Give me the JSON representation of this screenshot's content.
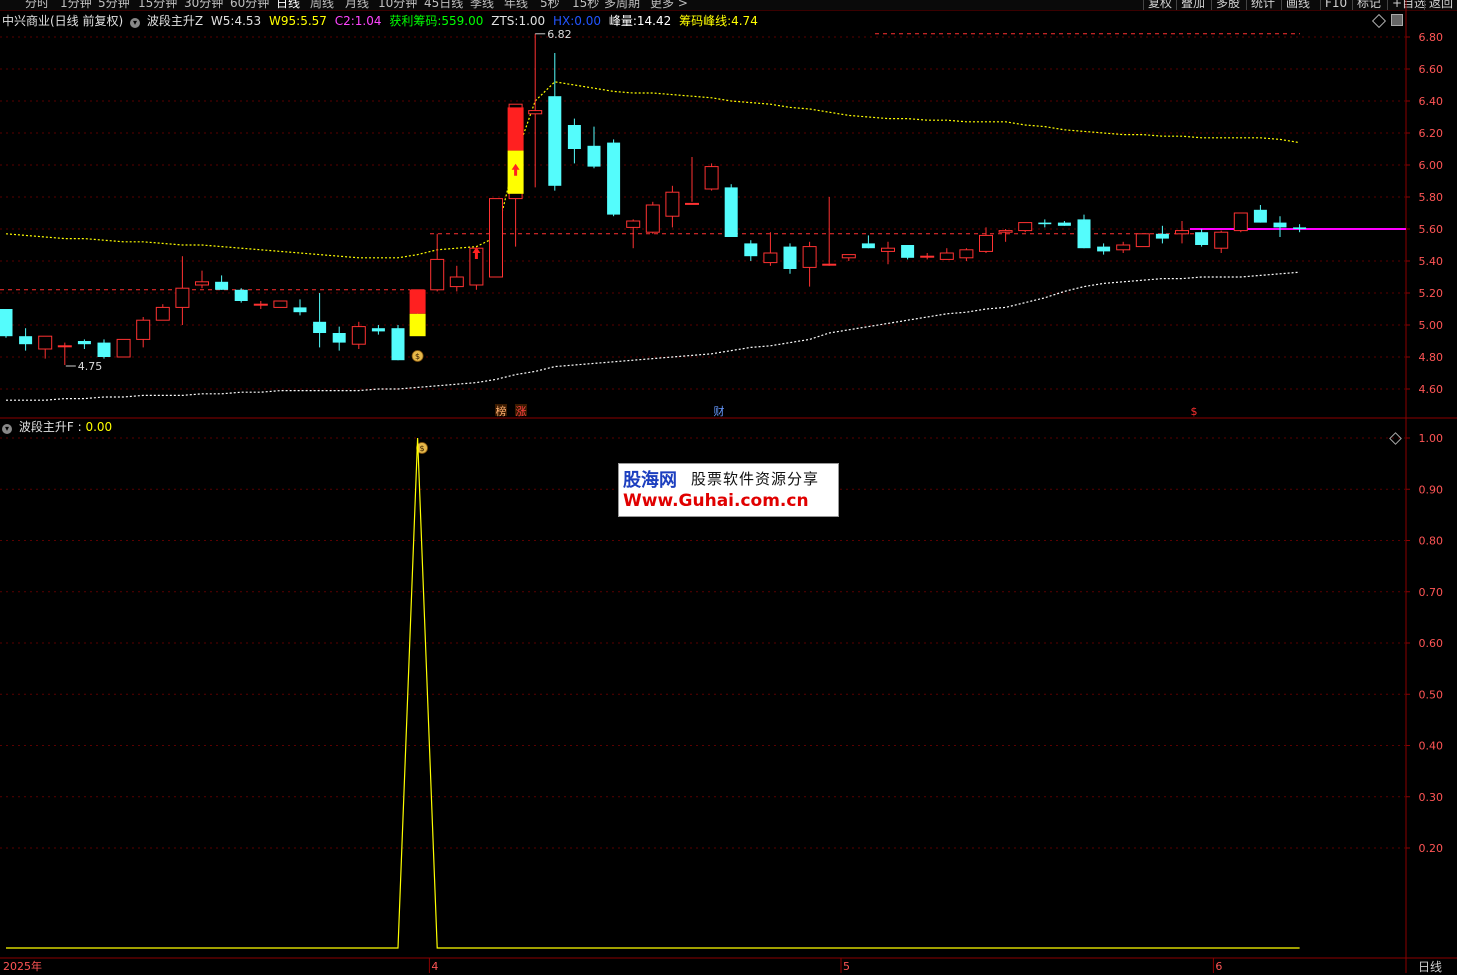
{
  "toolbar": {
    "periods": [
      "分时",
      "1分钟",
      "5分钟",
      "15分钟",
      "30分钟",
      "60分钟",
      "日线",
      "周线",
      "月线",
      "10分钟",
      "45日线",
      "季线",
      "年线",
      "5秒",
      "15秒",
      "多周期",
      "更多 >"
    ],
    "active_period": "日线",
    "right_buttons": [
      "复权",
      "叠加",
      "多股",
      "统计",
      "画线",
      "F10",
      "标记",
      "+自选",
      "返回"
    ]
  },
  "main_info": {
    "stock": "中兴商业(日线 前复权)",
    "indicator": "波段主升Z",
    "w5_label": "W5:",
    "w5_value": "4.53",
    "w95_label": "W95:",
    "w95_value": "5.57",
    "c2_label": "C2:",
    "c2_value": "1.04",
    "profit_label": "获利筹码:",
    "profit_value": "559.00",
    "zts_label": "ZTS:",
    "zts_value": "1.00",
    "hx_label": "HX:",
    "hx_value": "0.00",
    "peak_label": "峰量:",
    "peak_value": "14.42",
    "chip_label": "筹码峰线:",
    "chip_value": "4.74"
  },
  "sub_info": {
    "indicator": "波段主升F",
    "sep": ":",
    "value": "0.00"
  },
  "annotations": {
    "high": "6.82",
    "low": "4.75",
    "marks": [
      "榜",
      "涨",
      "财",
      "$"
    ]
  },
  "x_axis": {
    "labels": [
      "2025年",
      "4",
      "5",
      "6"
    ],
    "period_label": "日线"
  },
  "watermark": {
    "logo": "股海网",
    "slogan": "股票软件资源分享",
    "url": "Www.Guhai.com.cn"
  },
  "colors": {
    "up": "#ff3232",
    "down": "#54fcfc",
    "yellow": "#ffff00",
    "magenta": "#ff00ff",
    "axis": "#8b0000"
  },
  "chart_data": [
    {
      "type": "candlestick",
      "title": "中兴商业(日线 前复权)",
      "y_ticks": [
        4.6,
        4.8,
        5.0,
        5.2,
        5.4,
        5.6,
        5.8,
        6.0,
        6.2,
        6.4,
        6.6,
        6.8
      ],
      "ylim": [
        4.5,
        6.9
      ],
      "x_labels": [
        "2025年",
        "4",
        "5",
        "6"
      ],
      "ohlc": [
        [
          5.1,
          5.1,
          4.92,
          4.93
        ],
        [
          4.93,
          4.98,
          4.84,
          4.88
        ],
        [
          4.85,
          4.93,
          4.79,
          4.93
        ],
        [
          4.87,
          4.89,
          4.75,
          4.87
        ],
        [
          4.9,
          4.91,
          4.85,
          4.88
        ],
        [
          4.89,
          4.91,
          4.79,
          4.8
        ],
        [
          4.8,
          4.91,
          4.8,
          4.91
        ],
        [
          4.91,
          5.05,
          4.86,
          5.03
        ],
        [
          5.03,
          5.13,
          5.03,
          5.11
        ],
        [
          5.11,
          5.43,
          5.0,
          5.23
        ],
        [
          5.25,
          5.34,
          5.23,
          5.27
        ],
        [
          5.27,
          5.31,
          5.22,
          5.22
        ],
        [
          5.22,
          5.23,
          5.14,
          5.15
        ],
        [
          5.13,
          5.15,
          5.1,
          5.13
        ],
        [
          5.11,
          5.15,
          5.11,
          5.15
        ],
        [
          5.11,
          5.16,
          5.06,
          5.08
        ],
        [
          5.02,
          5.2,
          4.86,
          4.95
        ],
        [
          4.95,
          4.99,
          4.84,
          4.89
        ],
        [
          4.88,
          5.02,
          4.85,
          4.99
        ],
        [
          4.98,
          5.0,
          4.94,
          4.96
        ],
        [
          4.98,
          5.0,
          4.78,
          4.78
        ],
        [
          5.11,
          5.22,
          5.05,
          5.22
        ],
        [
          5.22,
          5.57,
          5.21,
          5.41
        ],
        [
          5.24,
          5.37,
          5.21,
          5.3
        ],
        [
          5.25,
          5.48,
          5.22,
          5.48
        ],
        [
          5.3,
          5.79,
          5.3,
          5.79
        ],
        [
          5.79,
          6.38,
          5.49,
          6.38
        ],
        [
          6.32,
          6.82,
          5.86,
          6.34
        ],
        [
          6.43,
          6.7,
          5.84,
          5.87
        ],
        [
          6.25,
          6.29,
          6.01,
          6.1
        ],
        [
          6.12,
          6.24,
          5.98,
          5.99
        ],
        [
          6.14,
          6.16,
          5.68,
          5.69
        ],
        [
          5.61,
          5.66,
          5.48,
          5.65
        ],
        [
          5.58,
          5.77,
          5.57,
          5.75
        ],
        [
          5.68,
          5.87,
          5.61,
          5.83
        ],
        [
          5.76,
          6.05,
          5.77,
          5.76
        ],
        [
          5.85,
          6.01,
          5.84,
          5.99
        ],
        [
          5.86,
          5.88,
          5.55,
          5.55
        ],
        [
          5.51,
          5.53,
          5.4,
          5.43
        ],
        [
          5.39,
          5.58,
          5.37,
          5.45
        ],
        [
          5.49,
          5.51,
          5.32,
          5.35
        ],
        [
          5.36,
          5.52,
          5.24,
          5.49
        ],
        [
          5.38,
          5.8,
          5.37,
          5.38
        ],
        [
          5.42,
          5.44,
          5.4,
          5.44
        ],
        [
          5.51,
          5.56,
          5.48,
          5.48
        ],
        [
          5.46,
          5.52,
          5.38,
          5.48
        ],
        [
          5.5,
          5.5,
          5.41,
          5.42
        ],
        [
          5.43,
          5.45,
          5.41,
          5.43
        ],
        [
          5.41,
          5.48,
          5.42,
          5.45
        ],
        [
          5.42,
          5.48,
          5.4,
          5.47
        ],
        [
          5.46,
          5.61,
          5.45,
          5.56
        ],
        [
          5.58,
          5.6,
          5.52,
          5.59
        ],
        [
          5.59,
          5.64,
          5.58,
          5.64
        ],
        [
          5.64,
          5.66,
          5.61,
          5.63
        ],
        [
          5.64,
          5.65,
          5.62,
          5.62
        ],
        [
          5.66,
          5.69,
          5.48,
          5.48
        ],
        [
          5.49,
          5.51,
          5.44,
          5.46
        ],
        [
          5.47,
          5.52,
          5.45,
          5.5
        ],
        [
          5.49,
          5.57,
          5.49,
          5.57
        ],
        [
          5.57,
          5.62,
          5.51,
          5.54
        ],
        [
          5.57,
          5.65,
          5.51,
          5.59
        ],
        [
          5.58,
          5.6,
          5.49,
          5.5
        ],
        [
          5.48,
          5.59,
          5.45,
          5.58
        ],
        [
          5.59,
          5.7,
          5.58,
          5.7
        ],
        [
          5.72,
          5.75,
          5.64,
          5.64
        ],
        [
          5.64,
          5.68,
          5.55,
          5.61
        ],
        [
          5.61,
          5.63,
          5.58,
          5.6
        ]
      ],
      "series": [
        {
          "name": "W95",
          "values": [
            5.57,
            5.56,
            5.55,
            5.54,
            5.54,
            5.53,
            5.52,
            5.52,
            5.51,
            5.5,
            5.5,
            5.49,
            5.48,
            5.47,
            5.46,
            5.45,
            5.44,
            5.43,
            5.42,
            5.42,
            5.42,
            5.44,
            5.47,
            5.48,
            5.49,
            5.55,
            6.05,
            6.4,
            6.52,
            6.5,
            6.48,
            6.46,
            6.45,
            6.45,
            6.44,
            6.43,
            6.42,
            6.4,
            6.39,
            6.38,
            6.36,
            6.35,
            6.33,
            6.31,
            6.3,
            6.29,
            6.29,
            6.28,
            6.28,
            6.27,
            6.27,
            6.27,
            6.25,
            6.24,
            6.22,
            6.21,
            6.2,
            6.19,
            6.19,
            6.18,
            6.18,
            6.17,
            6.17,
            6.17,
            6.17,
            6.16,
            6.14
          ]
        },
        {
          "name": "W5",
          "values": [
            4.53,
            4.53,
            4.53,
            4.54,
            4.54,
            4.55,
            4.55,
            4.56,
            4.56,
            4.56,
            4.57,
            4.57,
            4.58,
            4.58,
            4.59,
            4.59,
            4.59,
            4.59,
            4.59,
            4.6,
            4.6,
            4.61,
            4.62,
            4.63,
            4.64,
            4.66,
            4.69,
            4.71,
            4.74,
            4.75,
            4.76,
            4.77,
            4.78,
            4.79,
            4.8,
            4.81,
            4.82,
            4.84,
            4.86,
            4.87,
            4.89,
            4.91,
            4.95,
            4.97,
            4.99,
            5.01,
            5.03,
            5.05,
            5.07,
            5.08,
            5.1,
            5.11,
            5.14,
            5.17,
            5.21,
            5.24,
            5.26,
            5.27,
            5.28,
            5.29,
            5.29,
            5.3,
            5.3,
            5.3,
            5.31,
            5.32,
            5.33
          ]
        }
      ]
    },
    {
      "type": "line",
      "title": "波段主升F",
      "y_ticks": [
        0.2,
        0.3,
        0.4,
        0.5,
        0.6,
        0.7,
        0.8,
        0.9,
        1.0
      ],
      "ylim": [
        -0.02,
        1.04
      ],
      "series": [
        {
          "name": "波段主升F",
          "values": [
            0,
            0,
            0,
            0,
            0,
            0,
            0,
            0,
            0,
            0,
            0,
            0,
            0,
            0,
            0,
            0,
            0,
            0,
            0,
            0,
            0,
            1,
            0,
            0,
            0,
            0,
            0,
            0,
            0,
            0,
            0,
            0,
            0,
            0,
            0,
            0,
            0,
            0,
            0,
            0,
            0,
            0,
            0,
            0,
            0,
            0,
            0,
            0,
            0,
            0,
            0,
            0,
            0,
            0,
            0,
            0,
            0,
            0,
            0,
            0,
            0,
            0,
            0,
            0,
            0,
            0,
            0
          ]
        }
      ]
    }
  ]
}
